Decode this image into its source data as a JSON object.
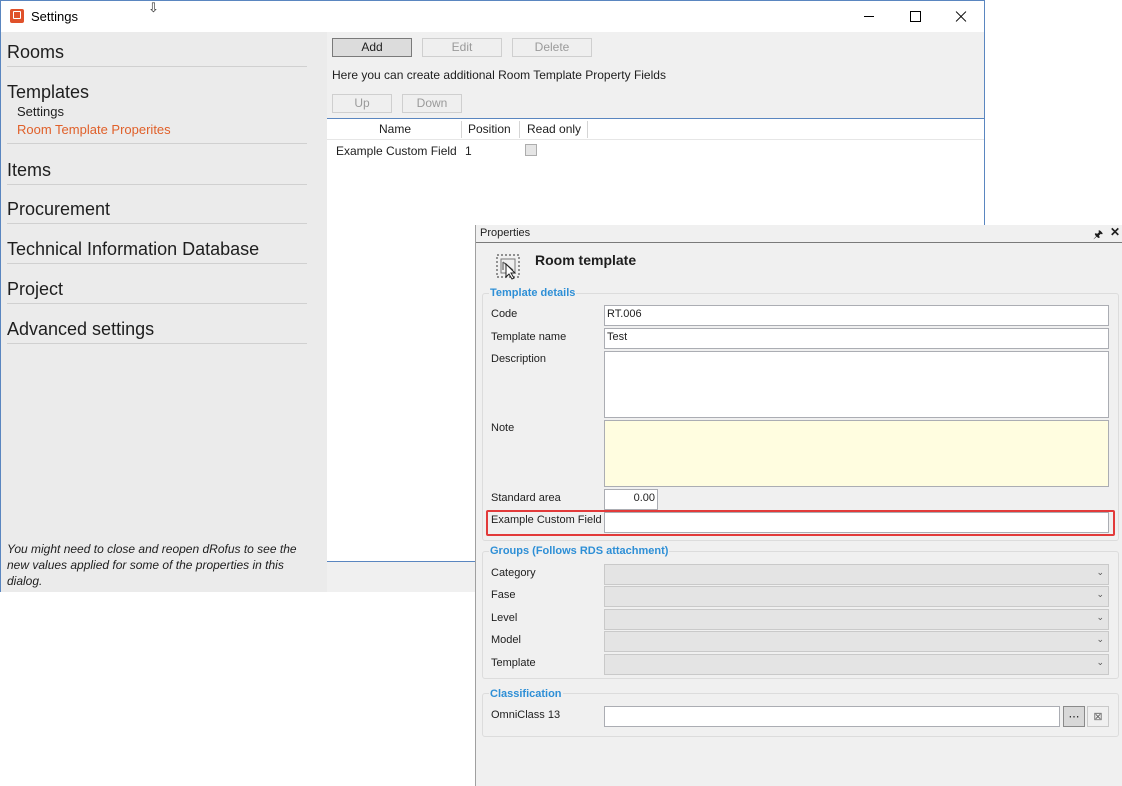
{
  "window": {
    "title": "Settings",
    "app_icon": "drofus-app-icon",
    "cursor_icon": "resize-cursor-icon"
  },
  "sidebar": {
    "sections": [
      {
        "label": "Rooms"
      },
      {
        "label": "Templates",
        "children": [
          {
            "label": "Settings",
            "active": false
          },
          {
            "label": "Room Template Properites",
            "active": true
          }
        ]
      },
      {
        "label": "Items"
      },
      {
        "label": "Procurement"
      },
      {
        "label": "Technical Information Database"
      },
      {
        "label": "Project"
      },
      {
        "label": "Advanced settings"
      }
    ],
    "note": "You might need to close and reopen dRofus to see the new values applied for some of the properties in this dialog.",
    "active_color": "#e0602a"
  },
  "toolbar": {
    "add": "Add",
    "edit": "Edit",
    "delete": "Delete",
    "info": "Here you can create additional Room Template Property Fields",
    "up": "Up",
    "down": "Down"
  },
  "grid": {
    "columns": [
      "Name",
      "Position",
      "Read only"
    ],
    "rows": [
      {
        "name": "Example Custom Field",
        "position": "1",
        "read_only": false
      }
    ]
  },
  "properties": {
    "panel_title": "Properties",
    "entity_title": "Room template",
    "entity_icon": "room-template-icon",
    "template_details": {
      "title": "Template details",
      "code_label": "Code",
      "code_value": "RT.006",
      "name_label": "Template name",
      "name_value": "Test",
      "description_label": "Description",
      "description_value": "",
      "note_label": "Note",
      "note_value": "",
      "area_label": "Standard area",
      "area_value": "0.00",
      "custom_label": "Example Custom Field",
      "custom_value": ""
    },
    "groups": {
      "title": "Groups (Follows RDS attachment)",
      "fields": [
        {
          "label": "Category",
          "value": ""
        },
        {
          "label": "Fase",
          "value": ""
        },
        {
          "label": "Level",
          "value": ""
        },
        {
          "label": "Model",
          "value": ""
        },
        {
          "label": "Template",
          "value": ""
        }
      ]
    },
    "classification": {
      "title": "Classification",
      "omniclass_label": "OmniClass 13",
      "omniclass_value": "",
      "browse_label": "⋯",
      "clear_icon": "clear-x-icon"
    },
    "accent_color": "#2e8fd6",
    "highlight_color": "#e23a3a",
    "note_bg": "#fffde0"
  }
}
